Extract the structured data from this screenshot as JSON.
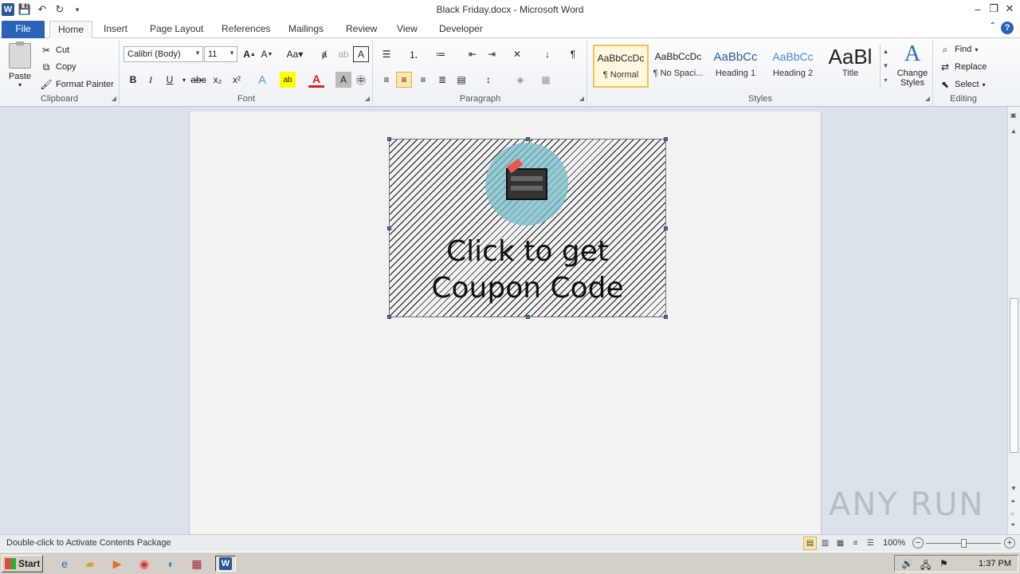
{
  "window": {
    "title": "Black Friday.docx - Microsoft Word"
  },
  "qat": {
    "icons": [
      "word-logo",
      "save-icon",
      "undo-icon",
      "redo-icon",
      "customize-icon"
    ]
  },
  "tabs": [
    {
      "label": "File"
    },
    {
      "label": "Home"
    },
    {
      "label": "Insert"
    },
    {
      "label": "Page Layout"
    },
    {
      "label": "References"
    },
    {
      "label": "Mailings"
    },
    {
      "label": "Review"
    },
    {
      "label": "View"
    },
    {
      "label": "Developer"
    }
  ],
  "clipboard": {
    "paste": "Paste",
    "cut": "Cut",
    "copy": "Copy",
    "format_painter": "Format Painter",
    "label": "Clipboard"
  },
  "font": {
    "name": "Calibri (Body)",
    "size": "11",
    "label": "Font",
    "buttons": [
      "B",
      "I",
      "U",
      "abc",
      "x₂",
      "x²"
    ]
  },
  "paragraph": {
    "label": "Paragraph"
  },
  "styles": {
    "label": "Styles",
    "items": [
      {
        "sample": "AaBbCcDc",
        "name": "¶ Normal"
      },
      {
        "sample": "AaBbCcDc",
        "name": "¶ No Spaci..."
      },
      {
        "sample": "AaBbCc",
        "name": "Heading 1"
      },
      {
        "sample": "AaBbCc",
        "name": "Heading 2"
      },
      {
        "sample": "AaBl",
        "name": "Title"
      }
    ],
    "change_styles": "Change Styles"
  },
  "editing": {
    "label": "Editing",
    "find": "Find",
    "replace": "Replace",
    "select": "Select"
  },
  "document": {
    "object_caption": "Click to get\nCoupon Code"
  },
  "status": {
    "text": "Double-click to Activate Contents Package",
    "zoom": "100%"
  },
  "watermark": "ANY RUN",
  "taskbar": {
    "start": "Start",
    "clock": "1:37 PM"
  },
  "colors": {
    "file_tab": "#2a62b8",
    "selected": "#fde7a8",
    "badge": "#78bec8"
  }
}
